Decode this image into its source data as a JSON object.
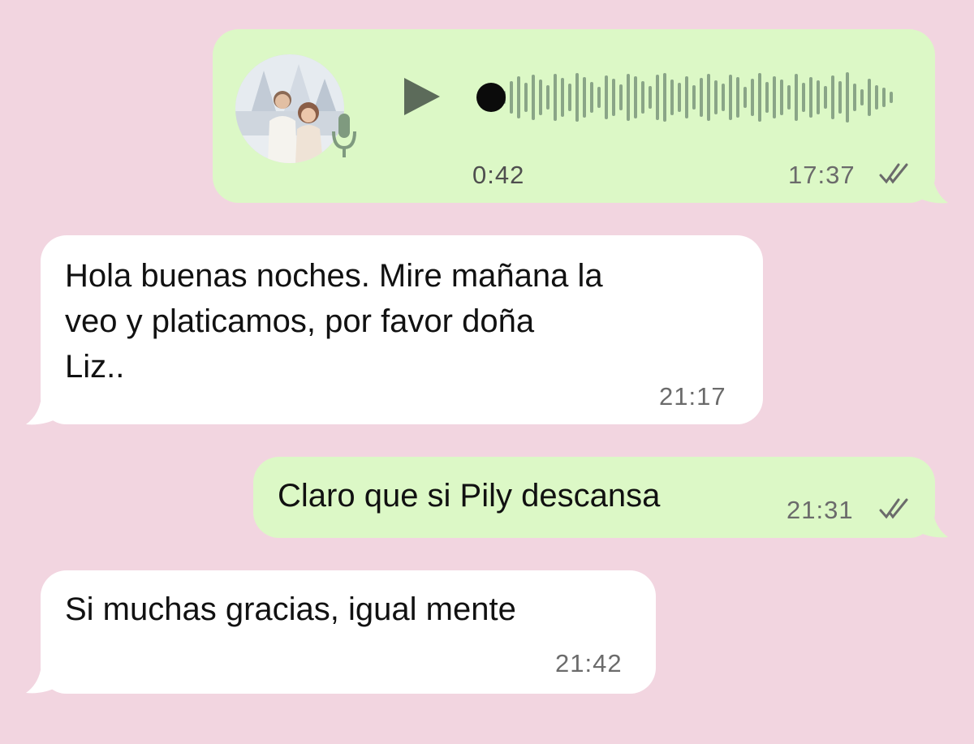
{
  "colors": {
    "background": "#f2d5e0",
    "outgoing_bubble": "#dcf8c6",
    "incoming_bubble": "#ffffff",
    "waveform": "#8aa587",
    "play_icon": "#5c6b5a"
  },
  "messages": [
    {
      "direction": "outgoing",
      "type": "voice",
      "duration": "0:42",
      "time": "17:37",
      "status_icon": "double-check-icon",
      "play_icon": "play-icon",
      "mic_icon": "microphone-icon",
      "progress": 0
    },
    {
      "direction": "incoming",
      "type": "text",
      "text": "Hola buenas noches. Mire mañana la\nveo y platicamos, por favor doña\nLiz..",
      "time": "21:17"
    },
    {
      "direction": "outgoing",
      "type": "text",
      "text": "Claro que si Pily descansa",
      "time": "21:31",
      "status_icon": "double-check-icon"
    },
    {
      "direction": "incoming",
      "type": "text",
      "text": "Si muchas gracias, igual mente",
      "time": "21:42"
    }
  ]
}
